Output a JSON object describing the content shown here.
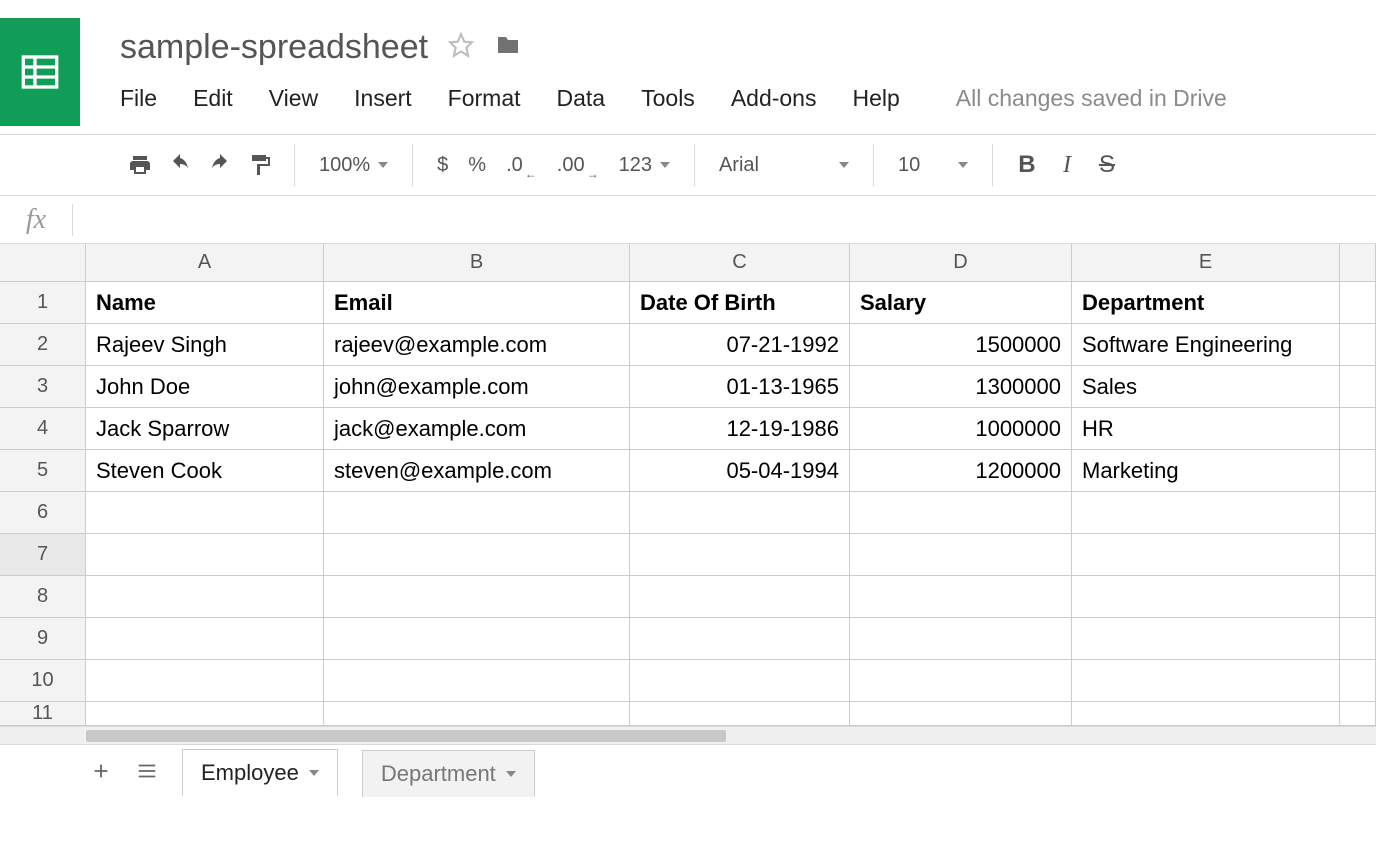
{
  "doc": {
    "title": "sample-spreadsheet"
  },
  "menu": {
    "file": "File",
    "edit": "Edit",
    "view": "View",
    "insert": "Insert",
    "format": "Format",
    "data": "Data",
    "tools": "Tools",
    "addons": "Add-ons",
    "help": "Help",
    "save_status": "All changes saved in Drive"
  },
  "toolbar": {
    "zoom": "100%",
    "currency": "$",
    "percent": "%",
    "dec_less": ".0",
    "dec_more": ".00",
    "number_123": "123",
    "font": "Arial",
    "font_size": "10"
  },
  "formula_bar": {
    "fx_label": "fx",
    "value": ""
  },
  "columns": {
    "A": "A",
    "B": "B",
    "C": "C",
    "D": "D",
    "E": "E"
  },
  "sheet": {
    "headers": {
      "name": "Name",
      "email": "Email",
      "dob": "Date Of Birth",
      "salary": "Salary",
      "dept": "Department"
    },
    "rows": [
      {
        "name": "Rajeev Singh",
        "email": "rajeev@example.com",
        "dob": "07-21-1992",
        "salary": "1500000",
        "dept": "Software Engineering"
      },
      {
        "name": "John Doe",
        "email": "john@example.com",
        "dob": "01-13-1965",
        "salary": "1300000",
        "dept": "Sales"
      },
      {
        "name": "Jack Sparrow",
        "email": "jack@example.com",
        "dob": "12-19-1986",
        "salary": "1000000",
        "dept": "HR"
      },
      {
        "name": "Steven Cook",
        "email": "steven@example.com",
        "dob": "05-04-1994",
        "salary": "1200000",
        "dept": "Marketing"
      }
    ],
    "row_labels": {
      "r1": "1",
      "r2": "2",
      "r3": "3",
      "r4": "4",
      "r5": "5",
      "r6": "6",
      "r7": "7",
      "r8": "8",
      "r9": "9",
      "r10": "10",
      "r11": "11"
    }
  },
  "tabs": {
    "employee": "Employee",
    "department": "Department"
  }
}
